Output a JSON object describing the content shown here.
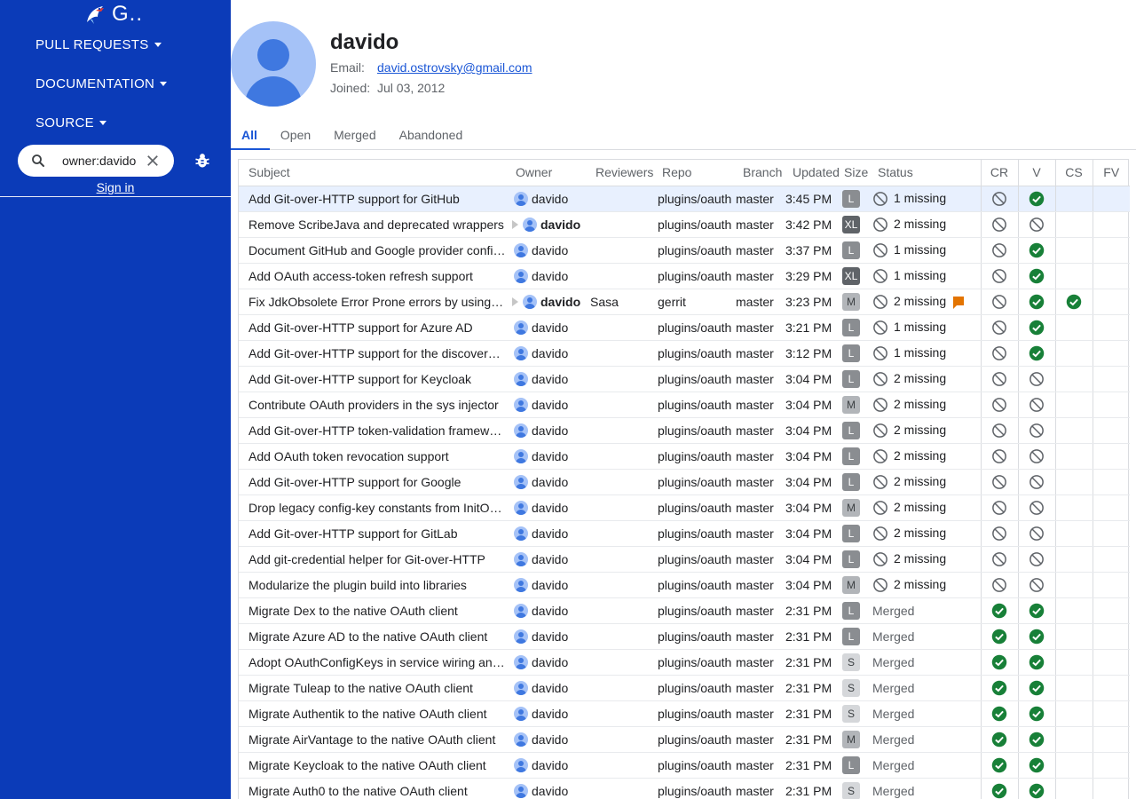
{
  "sidebar": {
    "logo_text": "G..",
    "nav": [
      "PULL REQUESTS",
      "DOCUMENTATION",
      "SOURCE"
    ],
    "search_value": "owner:davido",
    "sign_in": "Sign in"
  },
  "profile": {
    "name": "davido",
    "email_label": "Email:",
    "email": "david.ostrovsky@gmail.com",
    "joined_label": "Joined:",
    "joined": "Jul 03, 2012"
  },
  "tabs": [
    "All",
    "Open",
    "Merged",
    "Abandoned"
  ],
  "table": {
    "headers": [
      "Subject",
      "Owner",
      "Reviewers",
      "Repo",
      "Branch",
      "Updated",
      "Size",
      "Status",
      "CR",
      "V",
      "CS",
      "FV"
    ],
    "rows": [
      {
        "subject": "Add Git-over-HTTP support for GitHub",
        "owner": "davido",
        "attn": false,
        "reviewers": "",
        "repo": "plugins/oauth",
        "branch": "master",
        "updated": "3:45 PM",
        "size": "L",
        "status": "1 missing",
        "status_type": "missing",
        "flag": false,
        "cr": "block",
        "v": "ok",
        "cs": "",
        "fv": "",
        "selected": true
      },
      {
        "subject": "Remove ScribeJava and deprecated wrappers",
        "owner": "davido",
        "attn": true,
        "reviewers": "",
        "repo": "plugins/oauth",
        "branch": "master",
        "updated": "3:42 PM",
        "size": "XL",
        "status": "2 missing",
        "status_type": "missing",
        "flag": false,
        "cr": "block",
        "v": "block",
        "cs": "",
        "fv": "",
        "selected": false
      },
      {
        "subject": "Document GitHub and Google provider configuration",
        "owner": "davido",
        "attn": false,
        "reviewers": "",
        "repo": "plugins/oauth",
        "branch": "master",
        "updated": "3:37 PM",
        "size": "L",
        "status": "1 missing",
        "status_type": "missing",
        "flag": false,
        "cr": "block",
        "v": "ok",
        "cs": "",
        "fv": "",
        "selected": false
      },
      {
        "subject": "Add OAuth access-token refresh support",
        "owner": "davido",
        "attn": false,
        "reviewers": "",
        "repo": "plugins/oauth",
        "branch": "master",
        "updated": "3:29 PM",
        "size": "XL",
        "status": "1 missing",
        "status_type": "missing",
        "flag": false,
        "cr": "block",
        "v": "ok",
        "cs": "",
        "fv": "",
        "selected": false
      },
      {
        "subject": "Fix JdkObsolete Error Prone errors by using modern APIs",
        "owner": "davido",
        "attn": true,
        "reviewers": "Sasa",
        "repo": "gerrit",
        "branch": "master",
        "updated": "3:23 PM",
        "size": "M",
        "status": "2 missing",
        "status_type": "missing",
        "flag": true,
        "cr": "block",
        "v": "ok",
        "cs": "ok",
        "fv": "",
        "selected": false
      },
      {
        "subject": "Add Git-over-HTTP support for Azure AD",
        "owner": "davido",
        "attn": false,
        "reviewers": "",
        "repo": "plugins/oauth",
        "branch": "master",
        "updated": "3:21 PM",
        "size": "L",
        "status": "1 missing",
        "status_type": "missing",
        "flag": false,
        "cr": "block",
        "v": "ok",
        "cs": "",
        "fv": "",
        "selected": false
      },
      {
        "subject": "Add Git-over-HTTP support for the discovery-based providers",
        "owner": "davido",
        "attn": false,
        "reviewers": "",
        "repo": "plugins/oauth",
        "branch": "master",
        "updated": "3:12 PM",
        "size": "L",
        "status": "1 missing",
        "status_type": "missing",
        "flag": false,
        "cr": "block",
        "v": "ok",
        "cs": "",
        "fv": "",
        "selected": false
      },
      {
        "subject": "Add Git-over-HTTP support for Keycloak",
        "owner": "davido",
        "attn": false,
        "reviewers": "",
        "repo": "plugins/oauth",
        "branch": "master",
        "updated": "3:04 PM",
        "size": "L",
        "status": "2 missing",
        "status_type": "missing",
        "flag": false,
        "cr": "block",
        "v": "block",
        "cs": "",
        "fv": "",
        "selected": false
      },
      {
        "subject": "Contribute OAuth providers in the sys injector",
        "owner": "davido",
        "attn": false,
        "reviewers": "",
        "repo": "plugins/oauth",
        "branch": "master",
        "updated": "3:04 PM",
        "size": "M",
        "status": "2 missing",
        "status_type": "missing",
        "flag": false,
        "cr": "block",
        "v": "block",
        "cs": "",
        "fv": "",
        "selected": false
      },
      {
        "subject": "Add Git-over-HTTP token-validation framework",
        "owner": "davido",
        "attn": false,
        "reviewers": "",
        "repo": "plugins/oauth",
        "branch": "master",
        "updated": "3:04 PM",
        "size": "L",
        "status": "2 missing",
        "status_type": "missing",
        "flag": false,
        "cr": "block",
        "v": "block",
        "cs": "",
        "fv": "",
        "selected": false
      },
      {
        "subject": "Add OAuth token revocation support",
        "owner": "davido",
        "attn": false,
        "reviewers": "",
        "repo": "plugins/oauth",
        "branch": "master",
        "updated": "3:04 PM",
        "size": "L",
        "status": "2 missing",
        "status_type": "missing",
        "flag": false,
        "cr": "block",
        "v": "block",
        "cs": "",
        "fv": "",
        "selected": false
      },
      {
        "subject": "Add Git-over-HTTP support for Google",
        "owner": "davido",
        "attn": false,
        "reviewers": "",
        "repo": "plugins/oauth",
        "branch": "master",
        "updated": "3:04 PM",
        "size": "L",
        "status": "2 missing",
        "status_type": "missing",
        "flag": false,
        "cr": "block",
        "v": "block",
        "cs": "",
        "fv": "",
        "selected": false
      },
      {
        "subject": "Drop legacy config-key constants from InitOAuth",
        "owner": "davido",
        "attn": false,
        "reviewers": "",
        "repo": "plugins/oauth",
        "branch": "master",
        "updated": "3:04 PM",
        "size": "M",
        "status": "2 missing",
        "status_type": "missing",
        "flag": false,
        "cr": "block",
        "v": "block",
        "cs": "",
        "fv": "",
        "selected": false
      },
      {
        "subject": "Add Git-over-HTTP support for GitLab",
        "owner": "davido",
        "attn": false,
        "reviewers": "",
        "repo": "plugins/oauth",
        "branch": "master",
        "updated": "3:04 PM",
        "size": "L",
        "status": "2 missing",
        "status_type": "missing",
        "flag": false,
        "cr": "block",
        "v": "block",
        "cs": "",
        "fv": "",
        "selected": false
      },
      {
        "subject": "Add git-credential helper for Git-over-HTTP",
        "owner": "davido",
        "attn": false,
        "reviewers": "",
        "repo": "plugins/oauth",
        "branch": "master",
        "updated": "3:04 PM",
        "size": "L",
        "status": "2 missing",
        "status_type": "missing",
        "flag": false,
        "cr": "block",
        "v": "block",
        "cs": "",
        "fv": "",
        "selected": false
      },
      {
        "subject": "Modularize the plugin build into libraries",
        "owner": "davido",
        "attn": false,
        "reviewers": "",
        "repo": "plugins/oauth",
        "branch": "master",
        "updated": "3:04 PM",
        "size": "M",
        "status": "2 missing",
        "status_type": "missing",
        "flag": false,
        "cr": "block",
        "v": "block",
        "cs": "",
        "fv": "",
        "selected": false
      },
      {
        "subject": "Migrate Dex to the native OAuth client",
        "owner": "davido",
        "attn": false,
        "reviewers": "",
        "repo": "plugins/oauth",
        "branch": "master",
        "updated": "2:31 PM",
        "size": "L",
        "status": "Merged",
        "status_type": "merged",
        "flag": false,
        "cr": "ok",
        "v": "ok",
        "cs": "",
        "fv": "",
        "selected": false
      },
      {
        "subject": "Migrate Azure AD to the native OAuth client",
        "owner": "davido",
        "attn": false,
        "reviewers": "",
        "repo": "plugins/oauth",
        "branch": "master",
        "updated": "2:31 PM",
        "size": "L",
        "status": "Merged",
        "status_type": "merged",
        "flag": false,
        "cr": "ok",
        "v": "ok",
        "cs": "",
        "fv": "",
        "selected": false
      },
      {
        "subject": "Adopt OAuthConfigKeys in service wiring and init",
        "owner": "davido",
        "attn": false,
        "reviewers": "",
        "repo": "plugins/oauth",
        "branch": "master",
        "updated": "2:31 PM",
        "size": "S",
        "status": "Merged",
        "status_type": "merged",
        "flag": false,
        "cr": "ok",
        "v": "ok",
        "cs": "",
        "fv": "",
        "selected": false
      },
      {
        "subject": "Migrate Tuleap to the native OAuth client",
        "owner": "davido",
        "attn": false,
        "reviewers": "",
        "repo": "plugins/oauth",
        "branch": "master",
        "updated": "2:31 PM",
        "size": "S",
        "status": "Merged",
        "status_type": "merged",
        "flag": false,
        "cr": "ok",
        "v": "ok",
        "cs": "",
        "fv": "",
        "selected": false
      },
      {
        "subject": "Migrate Authentik to the native OAuth client",
        "owner": "davido",
        "attn": false,
        "reviewers": "",
        "repo": "plugins/oauth",
        "branch": "master",
        "updated": "2:31 PM",
        "size": "S",
        "status": "Merged",
        "status_type": "merged",
        "flag": false,
        "cr": "ok",
        "v": "ok",
        "cs": "",
        "fv": "",
        "selected": false
      },
      {
        "subject": "Migrate AirVantage to the native OAuth client",
        "owner": "davido",
        "attn": false,
        "reviewers": "",
        "repo": "plugins/oauth",
        "branch": "master",
        "updated": "2:31 PM",
        "size": "M",
        "status": "Merged",
        "status_type": "merged",
        "flag": false,
        "cr": "ok",
        "v": "ok",
        "cs": "",
        "fv": "",
        "selected": false
      },
      {
        "subject": "Migrate Keycloak to the native OAuth client",
        "owner": "davido",
        "attn": false,
        "reviewers": "",
        "repo": "plugins/oauth",
        "branch": "master",
        "updated": "2:31 PM",
        "size": "L",
        "status": "Merged",
        "status_type": "merged",
        "flag": false,
        "cr": "ok",
        "v": "ok",
        "cs": "",
        "fv": "",
        "selected": false
      },
      {
        "subject": "Migrate Auth0 to the native OAuth client",
        "owner": "davido",
        "attn": false,
        "reviewers": "",
        "repo": "plugins/oauth",
        "branch": "master",
        "updated": "2:31 PM",
        "size": "S",
        "status": "Merged",
        "status_type": "merged",
        "flag": false,
        "cr": "ok",
        "v": "ok",
        "cs": "",
        "fv": "",
        "selected": false
      }
    ]
  },
  "colors": {
    "sidebar_bg": "#0b3bb8",
    "link": "#1a56d6",
    "approved": "#188038",
    "blocked": "#5f6368"
  }
}
